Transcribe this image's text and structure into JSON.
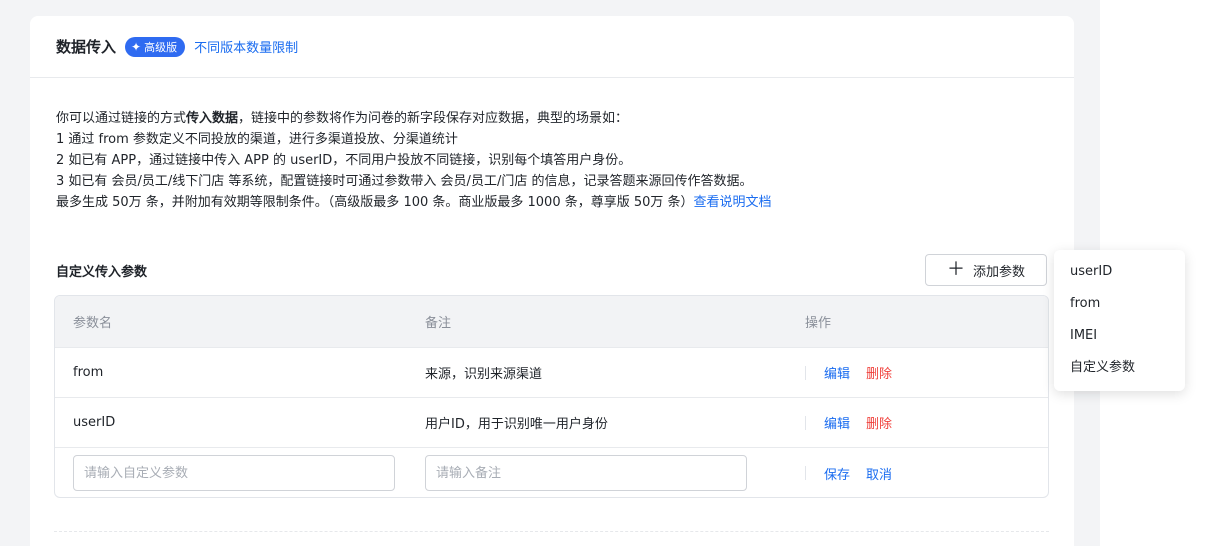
{
  "header": {
    "title": "数据传入",
    "badge_icon": "sparkle-icon",
    "badge": "高级版",
    "limit_link": "不同版本数量限制"
  },
  "description": {
    "line1_pre": "你可以通过链接的方式",
    "line1_bold": "传入数据",
    "line1_post": "，链接中的参数将作为问卷的新字段保存对应数据，典型的场景如：",
    "line2": "1 通过 from 参数定义不同投放的渠道，进行多渠道投放、分渠道统计",
    "line3": "2 如已有 APP，通过链接中传入 APP 的 userID，不同用户投放不同链接，识别每个填答用户身份。",
    "line4": "3 如已有 会员/员工/线下门店 等系统，配置链接时可通过参数带入 会员/员工/门店 的信息，记录答题来源回传作答数据。",
    "line5": "最多生成 50万 条，并附加有效期等限制条件。（高级版最多 100 条。商业版最多 1000 条，尊享版 50万 条）",
    "doc_link": "查看说明文档"
  },
  "params_section": {
    "title": "自定义传入参数",
    "add_button": "添加参数",
    "columns": [
      "参数名",
      "备注",
      "操作"
    ],
    "rows": [
      {
        "name": "from",
        "note": "来源，识别来源渠道",
        "edit": "编辑",
        "delete": "删除"
      },
      {
        "name": "userID",
        "note": "用户ID，用于识别唯一用户身份",
        "edit": "编辑",
        "delete": "删除"
      }
    ],
    "new_row": {
      "name_placeholder": "请输入自定义参数",
      "note_placeholder": "请输入备注",
      "save": "保存",
      "cancel": "取消"
    }
  },
  "dropdown": {
    "items": [
      "userID",
      "from",
      "IMEI",
      "自定义参数"
    ]
  },
  "colors": {
    "accent": "#1a6cf0",
    "danger": "#f0413c",
    "badge": "#2f6bf1"
  }
}
